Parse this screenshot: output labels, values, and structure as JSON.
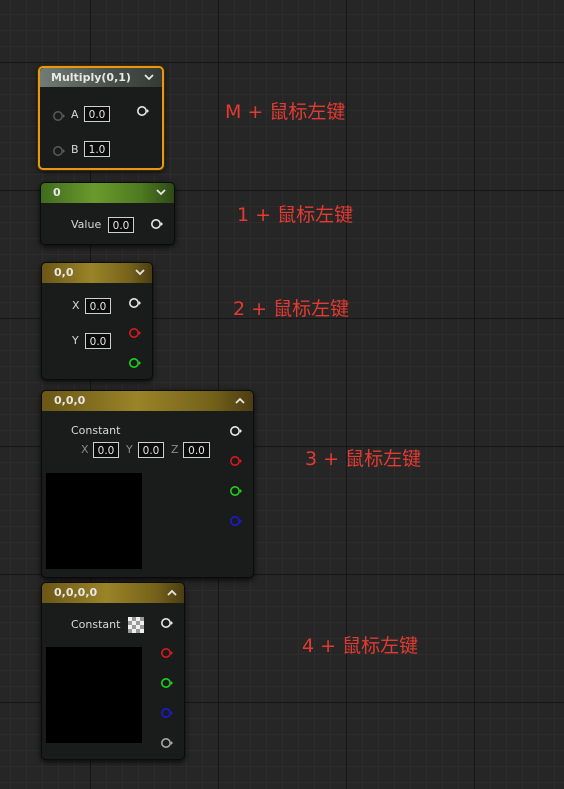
{
  "nodes": {
    "multiply": {
      "title": "Multiply(0,1)",
      "input_a_label": "A",
      "input_a_value": "0.0",
      "input_b_label": "B",
      "input_b_value": "1.0"
    },
    "constant1": {
      "title": "0",
      "value_label": "Value",
      "value": "0.0"
    },
    "constant2": {
      "title": "0,0",
      "x_label": "X",
      "x_value": "0.0",
      "y_label": "Y",
      "y_value": "0.0"
    },
    "constant3": {
      "title": "0,0,0",
      "constant_label": "Constant",
      "x_label": "X",
      "x_value": "0.0",
      "y_label": "Y",
      "y_value": "0.0",
      "z_label": "Z",
      "z_value": "0.0"
    },
    "constant4": {
      "title": "0,0,0,0",
      "constant_label": "Constant"
    }
  },
  "annotations": {
    "multiply": "M + 鼠标左键",
    "constant1": "1 + 鼠标左键",
    "constant2": "2 + 鼠标左键",
    "constant3": "3 + 鼠标左键",
    "constant4": "4 + 鼠标左键"
  },
  "colors": {
    "selection": "#e99713",
    "annotation": "#e33a32",
    "pin_white": "#e8e8e8",
    "pin_red": "#d81a1a",
    "pin_green": "#1ad41a",
    "pin_blue": "#1a1ad8",
    "pin_gray": "#a8a8a8"
  },
  "icons": [
    "chevron-down-icon",
    "chevron-up-icon",
    "output-pin-icon",
    "input-pin-icon",
    "checker-swatch-icon"
  ]
}
